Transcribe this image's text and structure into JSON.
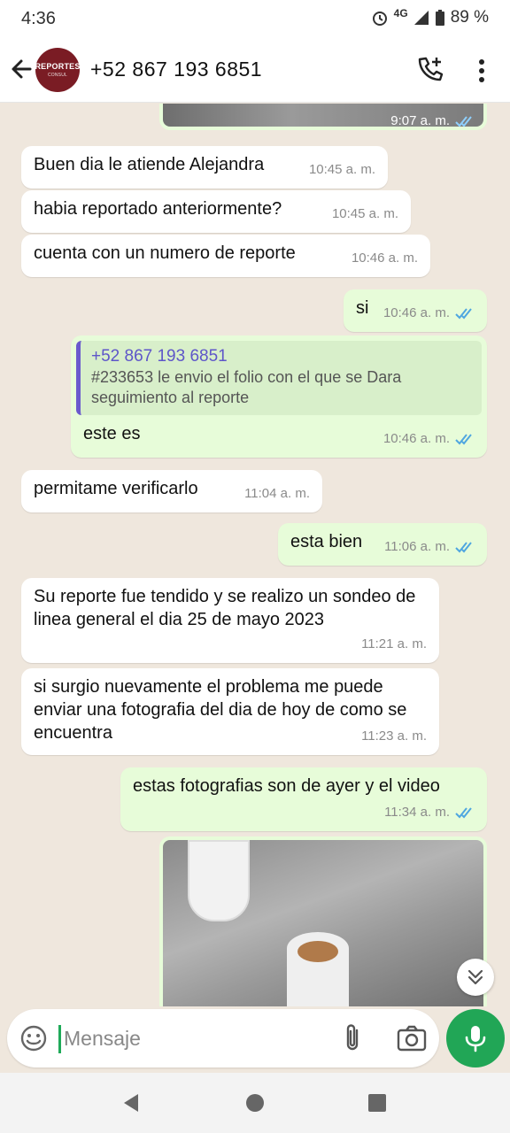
{
  "status": {
    "time": "4:36",
    "network": "4G",
    "battery": "89 %"
  },
  "header": {
    "contact": "+52 867 193 6851",
    "avatar_text": "REPORTES",
    "avatar_sub": "CONSUL"
  },
  "messages": [
    {
      "side": "out",
      "text": "",
      "time": "9:07 a. m."
    },
    {
      "side": "in",
      "text": "Buen dia le atiende Alejandra",
      "time": "10:45 a. m."
    },
    {
      "side": "in",
      "text": "habia reportado anteriormente?",
      "time": "10:45 a. m."
    },
    {
      "side": "in",
      "text": "cuenta con  un numero de reporte",
      "time": "10:46 a. m."
    },
    {
      "side": "out",
      "text": "si",
      "time": "10:46 a. m."
    },
    {
      "side": "out",
      "quote_name": "+52 867 193 6851",
      "quote_text": "#233653 le envio el folio con el que se Dara seguimiento al reporte",
      "text": "este es",
      "time": "10:46 a. m."
    },
    {
      "side": "in",
      "text": "permitame verificarlo",
      "time": "11:04 a. m."
    },
    {
      "side": "out",
      "text": "esta bien",
      "time": "11:06 a. m."
    },
    {
      "side": "in",
      "text": "Su reporte fue tendido y se realizo un sondeo de linea general el dia 25 de mayo 2023",
      "time": "11:21 a. m."
    },
    {
      "side": "in",
      "text": "si surgio nuevamente el problema me puede enviar una fotografia del dia de hoy de como se encuentra",
      "time": "11:23 a. m."
    },
    {
      "side": "out",
      "text": "estas fotografias son de ayer y el video",
      "time": "11:34 a. m."
    }
  ],
  "composer": {
    "placeholder": "Mensaje"
  },
  "colors": {
    "accent": "#21a656",
    "outgoing": "#e7fcd9",
    "incoming": "#ffffff",
    "chat_bg": "#efe7dd",
    "read_ticks": "#4fa6e0"
  }
}
